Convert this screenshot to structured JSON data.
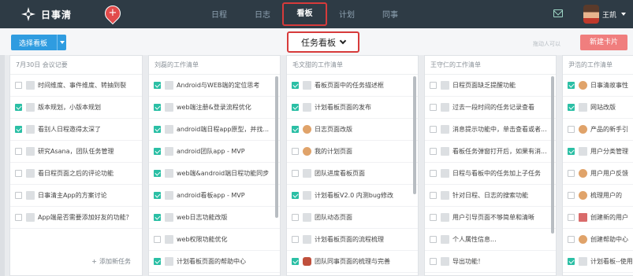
{
  "app": {
    "name": "日事清"
  },
  "nav": {
    "items": [
      {
        "label": "日程",
        "left": 0
      },
      {
        "label": "日志",
        "left": 0
      },
      {
        "label": "看板",
        "left": 0
      },
      {
        "label": "计划",
        "left": 0
      },
      {
        "label": "同事",
        "left": 0
      }
    ],
    "user": "王凯"
  },
  "toolbar": {
    "select_board": "选择看板",
    "board_title": "任务看板",
    "sort_hint": "拖动人可以",
    "new_card": "新建卡片"
  },
  "columns": [
    {
      "title": "7月30日 会议记要",
      "add_task": "添加新任务",
      "tasks": [
        {
          "done": false,
          "text": "时间维度、事件维度、转抽到裂"
        },
        {
          "done": true,
          "text": "版本规划，小版本规划"
        },
        {
          "done": true,
          "text": "看别人日程邀得太深了"
        },
        {
          "done": false,
          "text": "研究Asana，团队任务管理"
        },
        {
          "done": false,
          "text": "看日程页面之后的评论功能"
        },
        {
          "done": false,
          "text": "日事清主App的方案讨论"
        },
        {
          "done": false,
          "text": "App端是否需要添加好友的功能？"
        }
      ]
    },
    {
      "title": "刘磊的工作清单",
      "tasks": [
        {
          "done": true,
          "text": "Android与WEB端的定位思考"
        },
        {
          "done": true,
          "text": "web端注册&登录流程优化"
        },
        {
          "done": true,
          "text": "android端日程app原型，并找..."
        },
        {
          "done": true,
          "text": "android团队app - MVP"
        },
        {
          "done": true,
          "text": "web端&android端日程功能同步"
        },
        {
          "done": true,
          "text": "android看板app - MVP"
        },
        {
          "done": true,
          "text": "web日志功能改版"
        },
        {
          "done": false,
          "text": "web权限功能优化"
        },
        {
          "done": true,
          "text": "计划看板页面的帮助中心"
        }
      ]
    },
    {
      "title": "毛文甜的工作清单",
      "tasks": [
        {
          "done": true,
          "icon": "",
          "text": "看板页面中的任务描述框"
        },
        {
          "done": true,
          "icon": "",
          "text": "计划看板页面的发布"
        },
        {
          "done": true,
          "icon": "a1",
          "text": "日志页面改版"
        },
        {
          "done": false,
          "icon": "a1",
          "text": "我的计划页面"
        },
        {
          "done": false,
          "icon": "",
          "text": "团队进度看板页面"
        },
        {
          "done": true,
          "icon": "",
          "text": "计划看板V2.0 内测bug修改"
        },
        {
          "done": false,
          "icon": "",
          "text": "团队动态页面"
        },
        {
          "done": false,
          "icon": "",
          "text": "计划看板页面的流程梳理"
        },
        {
          "done": true,
          "icon": "a2",
          "text": "团队同事页面的梳理与完善"
        }
      ]
    },
    {
      "title": "王守仁的工作清单",
      "tasks": [
        {
          "done": false,
          "text": "日程页面缺乏提醒功能"
        },
        {
          "done": false,
          "text": "过去一段时间的任务记录查看"
        },
        {
          "done": false,
          "text": "消息提示功能中，单击查看或者..."
        },
        {
          "done": false,
          "text": "看板任务弹窗打开后，如果有消..."
        },
        {
          "done": false,
          "text": "日程与看板中的任务加上子任务"
        },
        {
          "done": false,
          "text": "针对日程、日志的搜索功能"
        },
        {
          "done": false,
          "text": "用户引导页面不够简单和清晰"
        },
        {
          "done": false,
          "text": "个人属性信息..."
        },
        {
          "done": false,
          "text": "导出功能！"
        }
      ]
    },
    {
      "title": "尹浩的工作清单",
      "tasks": [
        {
          "done": true,
          "icon": "a1",
          "text": "日事清故事性"
        },
        {
          "done": true,
          "icon": "",
          "text": "网站改版"
        },
        {
          "done": false,
          "icon": "a1",
          "text": "产品的新手引"
        },
        {
          "done": true,
          "icon": "",
          "text": "用户分类管理"
        },
        {
          "done": false,
          "icon": "a1",
          "text": "用户用户反馈"
        },
        {
          "done": false,
          "icon": "a1",
          "text": "梳理用户的"
        },
        {
          "done": false,
          "icon": "a4",
          "text": "创建新的用户"
        },
        {
          "done": false,
          "icon": "a1",
          "text": "创建帮助中心"
        },
        {
          "done": true,
          "icon": "",
          "text": "计划看板--使用"
        }
      ]
    }
  ]
}
